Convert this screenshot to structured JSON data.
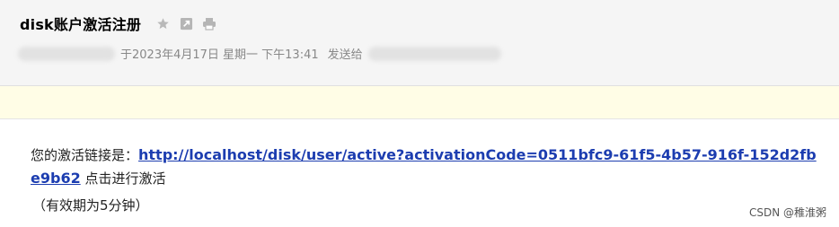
{
  "email": {
    "subject": "disk账户激活注册",
    "sent_time": "于2023年4月17日 星期一 下午13:41",
    "send_to_label": "发送给"
  },
  "toolbar": {
    "icons": [
      "star-icon",
      "open-new-window-icon",
      "print-icon"
    ]
  },
  "body": {
    "prefix": "您的激活链接是：",
    "link": "http://localhost/disk/user/active?activationCode=0511bfc9-61f5-4b57-916f-152d2fbe9b62",
    "suffix": " 点击进行激活",
    "validity": "（有效期为5分钟）"
  },
  "watermark": "CSDN @稚淮粥",
  "colors": {
    "header_bg": "#f5f5f5",
    "notice_bg": "#fffde6",
    "link": "#1c3db0"
  }
}
